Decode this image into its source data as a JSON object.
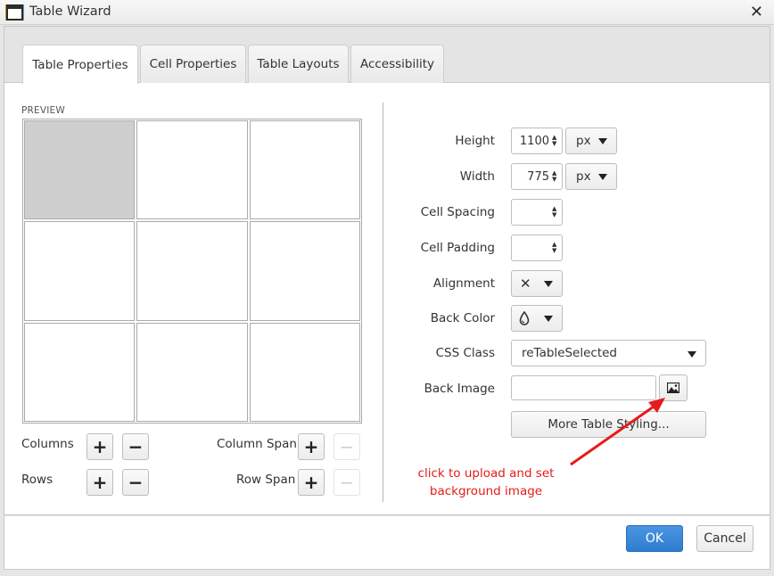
{
  "window": {
    "title": "Table Wizard",
    "title_icon": "window-icon",
    "close_icon": "close-icon",
    "close_glyph": "✕"
  },
  "tabs": [
    {
      "label": "Table Properties",
      "active": true
    },
    {
      "label": "Cell Properties",
      "active": false
    },
    {
      "label": "Table Layouts",
      "active": false
    },
    {
      "label": "Accessibility",
      "active": false
    }
  ],
  "preview": {
    "label": "PREVIEW",
    "rows": 3,
    "columns": 3,
    "selected_cell": [
      0,
      0
    ]
  },
  "grid_controls": {
    "columns_label": "Columns",
    "rows_label": "Rows",
    "column_span_label": "Column Span",
    "row_span_label": "Row Span",
    "plus_glyph": "+",
    "minus_glyph": "−",
    "column_span_minus_enabled": false,
    "row_span_minus_enabled": false
  },
  "properties": {
    "height": {
      "label": "Height",
      "value": "1100",
      "unit": "px"
    },
    "width": {
      "label": "Width",
      "value": "775",
      "unit": "px"
    },
    "cell_spacing": {
      "label": "Cell Spacing",
      "value": ""
    },
    "cell_padding": {
      "label": "Cell Padding",
      "value": ""
    },
    "alignment": {
      "label": "Alignment",
      "value_glyph": "✕"
    },
    "back_color": {
      "label": "Back Color",
      "icon": "drop-icon"
    },
    "css_class": {
      "label": "CSS Class",
      "value": "reTableSelected"
    },
    "back_image": {
      "label": "Back Image",
      "value": "",
      "button_icon": "image-icon"
    },
    "more_styling_label": "More Table Styling..."
  },
  "annotation": {
    "line1": "click to upload and set",
    "line2": "background image",
    "color": "#e61b1b"
  },
  "footer": {
    "ok_label": "OK",
    "cancel_label": "Cancel",
    "accent": "#3a88d8"
  }
}
